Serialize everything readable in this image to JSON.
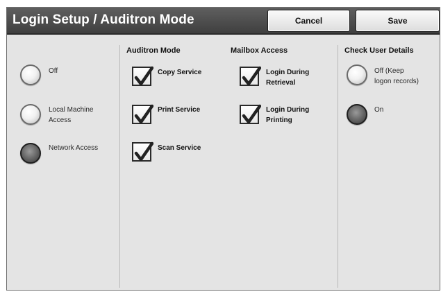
{
  "header": {
    "title": "Login Setup / Auditron Mode",
    "cancel_label": "Cancel",
    "save_label": "Save"
  },
  "login_type": {
    "options": [
      {
        "label": "Off",
        "selected": false
      },
      {
        "label": "Local Machine\nAccess",
        "selected": false
      },
      {
        "label": "Network Access",
        "selected": true
      }
    ]
  },
  "auditron_mode": {
    "heading": "Auditron Mode",
    "items": [
      {
        "label": "Copy Service",
        "checked": true
      },
      {
        "label": "Print Service",
        "checked": true
      },
      {
        "label": "Scan Service",
        "checked": true
      }
    ]
  },
  "mailbox_access": {
    "heading": "Mailbox Access",
    "items": [
      {
        "label": "Login During\nRetrieval",
        "checked": true
      },
      {
        "label": "Login During\nPrinting",
        "checked": true
      }
    ]
  },
  "check_user_details": {
    "heading": "Check User Details",
    "options": [
      {
        "label": "Off (Keep\nlogon records)",
        "selected": false
      },
      {
        "label": "On",
        "selected": true
      }
    ]
  }
}
